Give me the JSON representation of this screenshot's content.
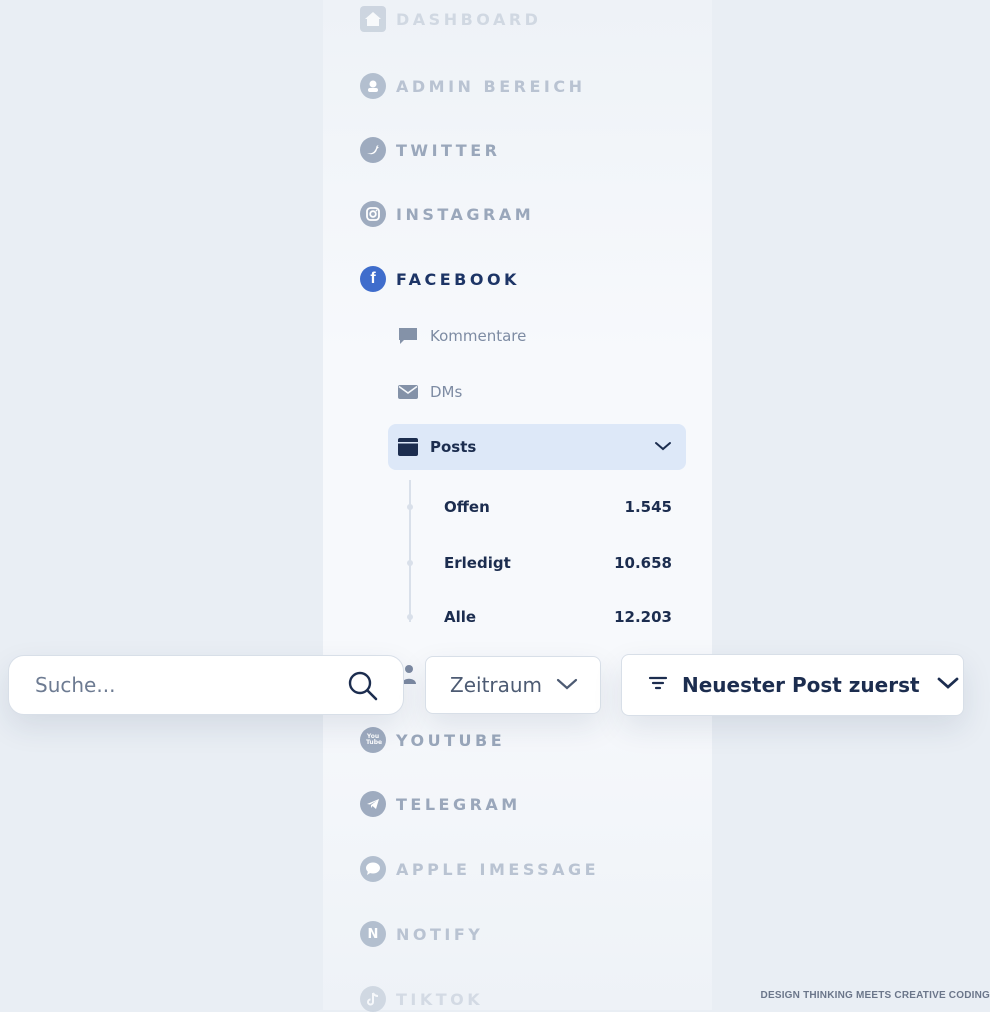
{
  "nav": [
    {
      "id": "dashboard",
      "label": "DASHBOARD",
      "icon": "home-icon"
    },
    {
      "id": "admin",
      "label": "ADMIN BEREICH",
      "icon": "admin-icon"
    },
    {
      "id": "twitter",
      "label": "TWITTER",
      "icon": "twitter-icon"
    },
    {
      "id": "instagram",
      "label": "INSTAGRAM",
      "icon": "instagram-icon"
    },
    {
      "id": "facebook",
      "label": "FACEBOOK",
      "icon": "facebook-icon",
      "icon_glyph": "f"
    },
    {
      "id": "youtube",
      "label": "YOUTUBE",
      "icon": "youtube-icon",
      "icon_glyph": "You Tube"
    },
    {
      "id": "telegram",
      "label": "TELEGRAM",
      "icon": "telegram-icon"
    },
    {
      "id": "imessage",
      "label": "APPLE IMESSAGE",
      "icon": "imessage-icon"
    },
    {
      "id": "notify",
      "label": "NOTIFY",
      "icon": "notify-icon",
      "icon_glyph": "N"
    },
    {
      "id": "tiktok",
      "label": "TIKTOK",
      "icon": "tiktok-icon"
    }
  ],
  "facebook_sub": {
    "comments": "Kommentare",
    "dms": "DMs",
    "posts": "Posts"
  },
  "posts_rows": [
    {
      "label": "Offen",
      "count": "1.545"
    },
    {
      "label": "Erledigt",
      "count": "10.658"
    },
    {
      "label": "Alle",
      "count": "12.203"
    }
  ],
  "search": {
    "placeholder": "Suche..."
  },
  "zeitraum_label": "Zeitraum",
  "sort_label": "Neuester Post zuerst",
  "footer": "DESIGN THINKING MEETS CREATIVE CODING",
  "colors": {
    "accent": "#3f6dcc",
    "primary_text": "#1c2d4f",
    "active_bg": "#dde8f8"
  }
}
